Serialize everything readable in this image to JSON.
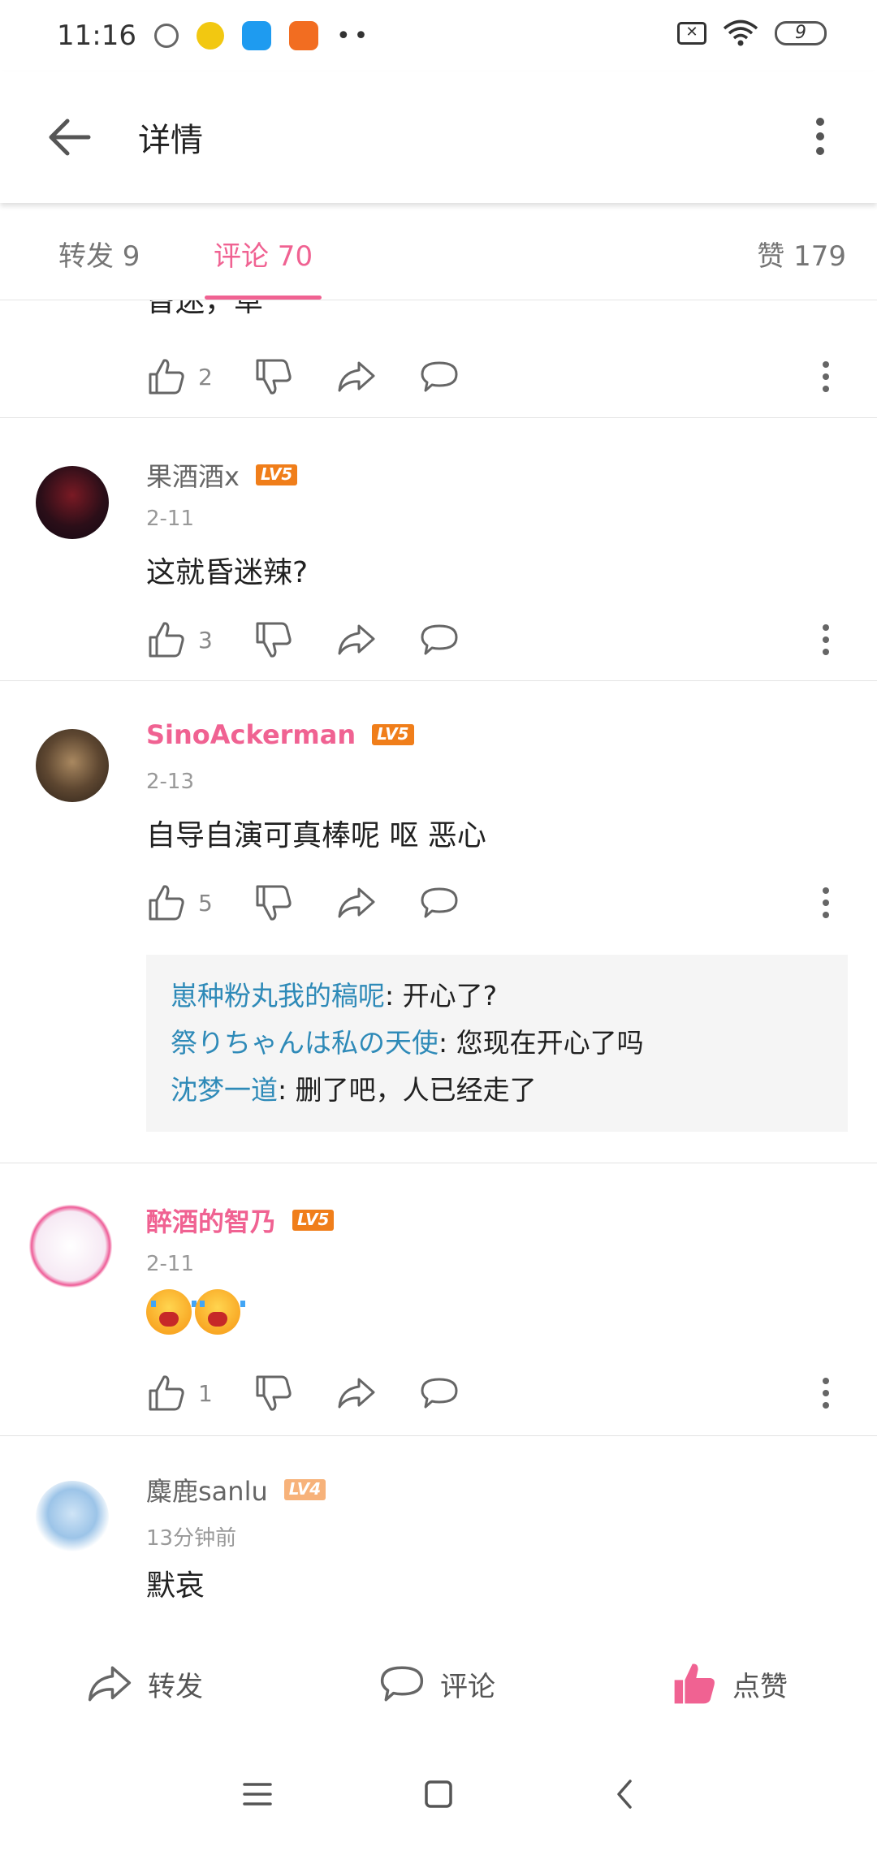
{
  "status_bar": {
    "time": "11:16",
    "battery": "9",
    "notif_dots": "••"
  },
  "app_bar": {
    "title": "详情"
  },
  "tabs": {
    "repost": "转发 9",
    "comments": "评论 70",
    "likes": "赞 179",
    "active": "comments"
  },
  "comments": [
    {
      "partial_text": "昏迷，草",
      "likes": "2"
    },
    {
      "user": "果酒酒x",
      "level": "LV5",
      "date": "2-11",
      "text": "这就昏迷辣?",
      "likes": "3"
    },
    {
      "user": "SinoAckerman",
      "level": "LV5",
      "date": "2-13",
      "text": "自导自演可真棒呢 呕 恶心",
      "likes": "5",
      "replies": [
        {
          "user": "崽种粉丸我的稿呢",
          "text": ": 开心了?"
        },
        {
          "user": "祭りちゃんは私の天使",
          "text": ": 您现在开心了吗"
        },
        {
          "user": "沈梦一道",
          "text": ": 删了吧，人已经走了"
        }
      ]
    },
    {
      "user": "醉酒的智乃",
      "level": "LV5",
      "date": "2-11",
      "text": "",
      "emoji": [
        "crying-face",
        "crying-face"
      ],
      "likes": "1"
    },
    {
      "user": "麋鹿sanlu",
      "level": "LV4",
      "date": "13分钟前",
      "text": "默哀"
    }
  ],
  "bottom_bar": {
    "repost": "转发",
    "comment": "评论",
    "like": "点赞"
  },
  "colors": {
    "accent": "#f06292",
    "reply_user": "#2e8ab8",
    "level_badge": "#f07e1a"
  }
}
